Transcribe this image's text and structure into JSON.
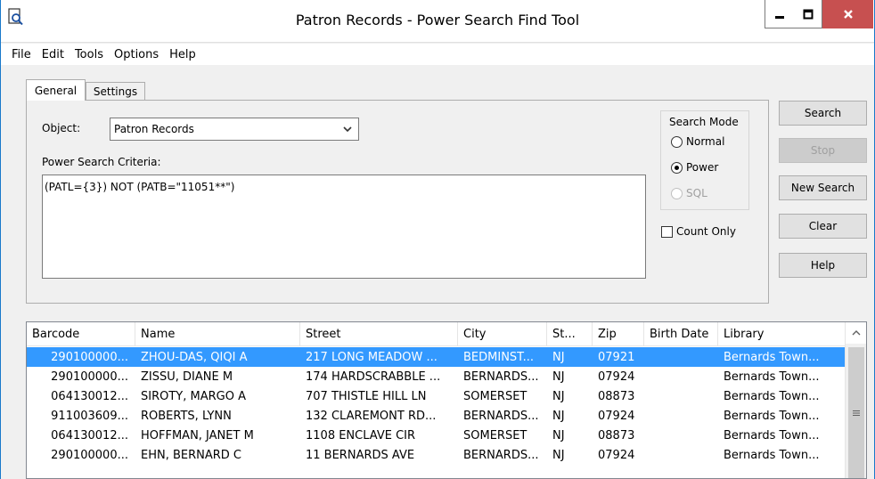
{
  "window": {
    "title": "Patron Records - Power Search Find Tool"
  },
  "menu": [
    "File",
    "Edit",
    "Tools",
    "Options",
    "Help"
  ],
  "tabs": {
    "general": "General",
    "settings": "Settings"
  },
  "form": {
    "object_label": "Object:",
    "object_value": "Patron Records",
    "criteria_label": "Power Search Criteria:",
    "criteria_value": "(PATL={3}) NOT (PATB=\"11051**\")"
  },
  "search_mode": {
    "label": "Search Mode",
    "normal": "Normal",
    "power": "Power",
    "sql": "SQL",
    "selected": "Power"
  },
  "count_only": "Count Only",
  "buttons": {
    "search": "Search",
    "stop": "Stop",
    "new_search": "New Search",
    "clear": "Clear",
    "help": "Help"
  },
  "table": {
    "columns": [
      "Barcode",
      "Name",
      "Street",
      "City",
      "St...",
      "Zip",
      "Birth Date",
      "Library"
    ],
    "rows": [
      [
        "290100000...",
        "ZHOU-DAS, QIQI A",
        "217 LONG MEADOW ...",
        "BEDMINST...",
        "NJ",
        "07921",
        "",
        "Bernards Town..."
      ],
      [
        "290100000...",
        "ZISSU, DIANE M",
        "174 HARDSCRABBLE ...",
        "BERNARDS...",
        "NJ",
        "07924",
        "",
        "Bernards Town..."
      ],
      [
        "064130012...",
        "SIROTY, MARGO A",
        "707 THISTLE HILL LN",
        "SOMERSET",
        "NJ",
        "08873",
        "",
        "Bernards Town..."
      ],
      [
        "911003609...",
        "ROBERTS, LYNN",
        "132 CLAREMONT RD...",
        "BERNARDS...",
        "NJ",
        "07924",
        "",
        "Bernards Town..."
      ],
      [
        "064130012...",
        "HOFFMAN, JANET M",
        "1108 ENCLAVE CIR",
        "SOMERSET",
        "NJ",
        "08873",
        "",
        "Bernards Town..."
      ],
      [
        "290100000...",
        "EHN, BERNARD C",
        "11 BERNARDS AVE",
        "BERNARDS...",
        "NJ",
        "07924",
        "",
        "Bernards Town..."
      ]
    ],
    "selected_row": 0
  },
  "colors": {
    "selection": "#3399ff",
    "close_button": "#c75050",
    "window_border": "#1979ca"
  }
}
